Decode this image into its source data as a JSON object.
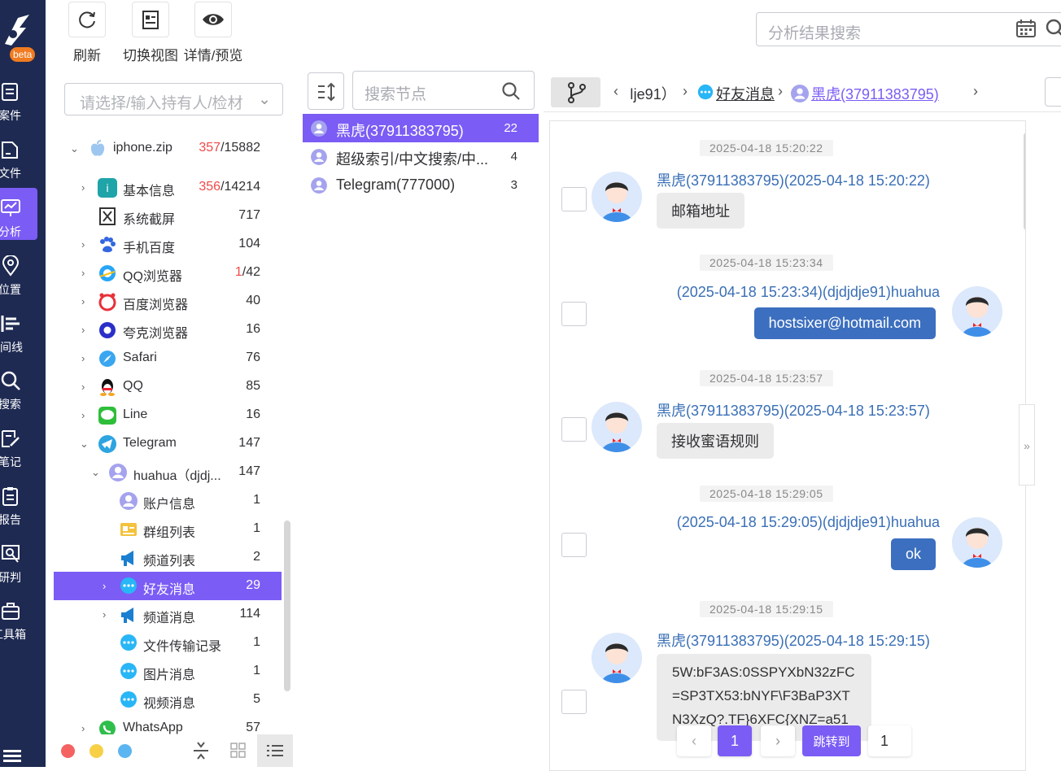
{
  "nav": {
    "beta": "beta",
    "items": [
      {
        "label": "案件",
        "icon": "case-icon"
      },
      {
        "label": "文件",
        "icon": "file-icon"
      },
      {
        "label": "分析",
        "icon": "analysis-icon"
      },
      {
        "label": "位置",
        "icon": "location-icon"
      },
      {
        "label": "时间线",
        "icon": "timeline-icon"
      },
      {
        "label": "搜索",
        "icon": "search-icon"
      },
      {
        "label": "笔记",
        "icon": "note-icon"
      },
      {
        "label": "报告",
        "icon": "report-icon"
      },
      {
        "label": "研判",
        "icon": "research-icon"
      },
      {
        "label": "工具箱",
        "icon": "toolbox-icon"
      }
    ],
    "active": "分析"
  },
  "toolbar": {
    "refresh": "刷新",
    "switch_view": "切换视图",
    "detail_preview": "详情/预览",
    "search_placeholder": "分析结果搜索"
  },
  "left": {
    "select_placeholder": "请选择/输入持有人/检材",
    "tree": [
      {
        "label": "iphone.zip",
        "count_red": "357",
        "count": "/15882",
        "icon": "apple-icon"
      },
      {
        "label": "基本信息",
        "count_red": "356",
        "count": "/14214",
        "icon": "basic-info-icon"
      },
      {
        "label": "系统截屏",
        "count_red": "",
        "count": "717",
        "icon": "screenshot-icon"
      },
      {
        "label": "手机百度",
        "count_red": "",
        "count": "104",
        "icon": "baidu-icon"
      },
      {
        "label": "QQ浏览器",
        "count_red": "1",
        "count": "/42",
        "icon": "qq-browser-icon"
      },
      {
        "label": "百度浏览器",
        "count_red": "",
        "count": "40",
        "icon": "baidu-browser-icon"
      },
      {
        "label": "夸克浏览器",
        "count_red": "",
        "count": "16",
        "icon": "quark-icon"
      },
      {
        "label": "Safari",
        "count_red": "",
        "count": "76",
        "icon": "safari-icon"
      },
      {
        "label": "QQ",
        "count_red": "",
        "count": "85",
        "icon": "qq-icon"
      },
      {
        "label": "Line",
        "count_red": "",
        "count": "16",
        "icon": "line-icon"
      },
      {
        "label": "Telegram",
        "count_red": "",
        "count": "147",
        "icon": "telegram-icon"
      },
      {
        "label": "huahua（djdj...",
        "count_red": "",
        "count": "147",
        "icon": "user-icon"
      },
      {
        "label": "账户信息",
        "count_red": "",
        "count": "1",
        "icon": "account-icon"
      },
      {
        "label": "群组列表",
        "count_red": "",
        "count": "1",
        "icon": "group-icon"
      },
      {
        "label": "频道列表",
        "count_red": "",
        "count": "2",
        "icon": "channel-icon"
      },
      {
        "label": "好友消息",
        "count_red": "",
        "count": "29",
        "icon": "chat-icon"
      },
      {
        "label": "频道消息",
        "count_red": "",
        "count": "114",
        "icon": "channel-icon"
      },
      {
        "label": "文件传输记录",
        "count_red": "",
        "count": "1",
        "icon": "chat-icon"
      },
      {
        "label": "图片消息",
        "count_red": "",
        "count": "1",
        "icon": "chat-icon"
      },
      {
        "label": "视频消息",
        "count_red": "",
        "count": "5",
        "icon": "chat-icon"
      },
      {
        "label": "WhatsApp",
        "count_red": "",
        "count": "57",
        "icon": "whatsapp-icon"
      }
    ]
  },
  "mid": {
    "search_placeholder": "搜索节点",
    "nodes": [
      {
        "label": "黑虎(37911383795)",
        "count": "22"
      },
      {
        "label": "超级索引/中文搜索/中...",
        "count": "4"
      },
      {
        "label": "Telegram(777000)",
        "count": "3"
      }
    ]
  },
  "crumbs": {
    "part1": "ǀje91）",
    "part2": "好友消息",
    "part3": "黑虎(37911383795)"
  },
  "messages": [
    {
      "time": "2025-04-18 15:20:22",
      "sender": "黑虎(37911383795)(2025-04-18 15:20:22)",
      "text": "邮箱地址",
      "dir": "in"
    },
    {
      "time": "2025-04-18 15:23:34",
      "sender": "(2025-04-18 15:23:34)(djdjdje91)huahua",
      "text": "hostsixer@hotmail.com",
      "dir": "out"
    },
    {
      "time": "2025-04-18 15:23:57",
      "sender": "黑虎(37911383795)(2025-04-18 15:23:57)",
      "text": "接收蜜语规则",
      "dir": "in"
    },
    {
      "time": "2025-04-18 15:29:05",
      "sender": "(2025-04-18 15:29:05)(djdjdje91)huahua",
      "text": "ok",
      "dir": "out"
    },
    {
      "time": "2025-04-18 15:29:15",
      "sender": "黑虎(37911383795)(2025-04-18 15:29:15)",
      "text_lines": [
        "5W:bF3AS:0SSPYXbN32zFC",
        "=SP3TX53:bNYF\\F3BaP3XT",
        "N3XzQ?.TF}6XFC{XNZ=a51"
      ],
      "dir": "in"
    }
  ],
  "pager": {
    "current": "1",
    "jump_label": "跳转到",
    "jump_value": "1"
  },
  "colors": {
    "accent": "#7b5cf5",
    "nav_bg": "#1e2a52",
    "out_bubble": "#3c6fbf",
    "link": "#3a6fb6"
  }
}
